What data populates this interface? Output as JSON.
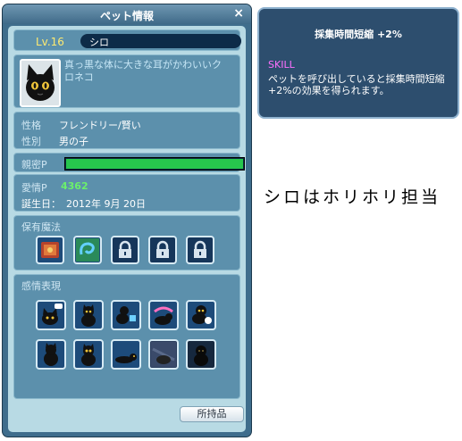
{
  "window": {
    "title": "ペット情報",
    "close": "×"
  },
  "pet": {
    "level": "Lv.16",
    "name": "シロ",
    "description": "真っ黒な体に大きな耳がかわいいクロネコ",
    "personality_label": "性格",
    "personality": "フレンドリー/賢い",
    "gender_label": "性別",
    "gender": "男の子",
    "intimacy_label": "親密P",
    "intimacy_fraction": 1.0,
    "affection_label": "愛情P",
    "affection": "4362",
    "birthday_label": "誕生日：",
    "birthday": "2012年 9月 20日"
  },
  "magic": {
    "label": "保有魔法",
    "slots": [
      "book-icon",
      "swirl-icon",
      "lock-icon",
      "lock-icon",
      "lock-icon"
    ]
  },
  "emotes": {
    "label": "感情表現",
    "slots": [
      "cat-hi-icon",
      "cat-sit-icon",
      "cat-cup-icon",
      "cat-fish-icon",
      "cat-shock-icon",
      "cat-back-icon",
      "cat-front-icon",
      "cat-lying-icon",
      "cat-dark-icon",
      "cat-shadow-icon"
    ]
  },
  "buttons": {
    "items": "所持品"
  },
  "tooltip": {
    "title": "採集時間短縮 +2%",
    "skill": "SKILL",
    "description": "ペットを呼び出していると採集時間短縮+2%の効果を得られます。"
  },
  "caption": "シロはホリホリ担当",
  "colors": {
    "intimacy_bar": "#27c64d",
    "skill": "#ff70ff",
    "level": "#ffea70",
    "affection": "#6bf06b"
  }
}
